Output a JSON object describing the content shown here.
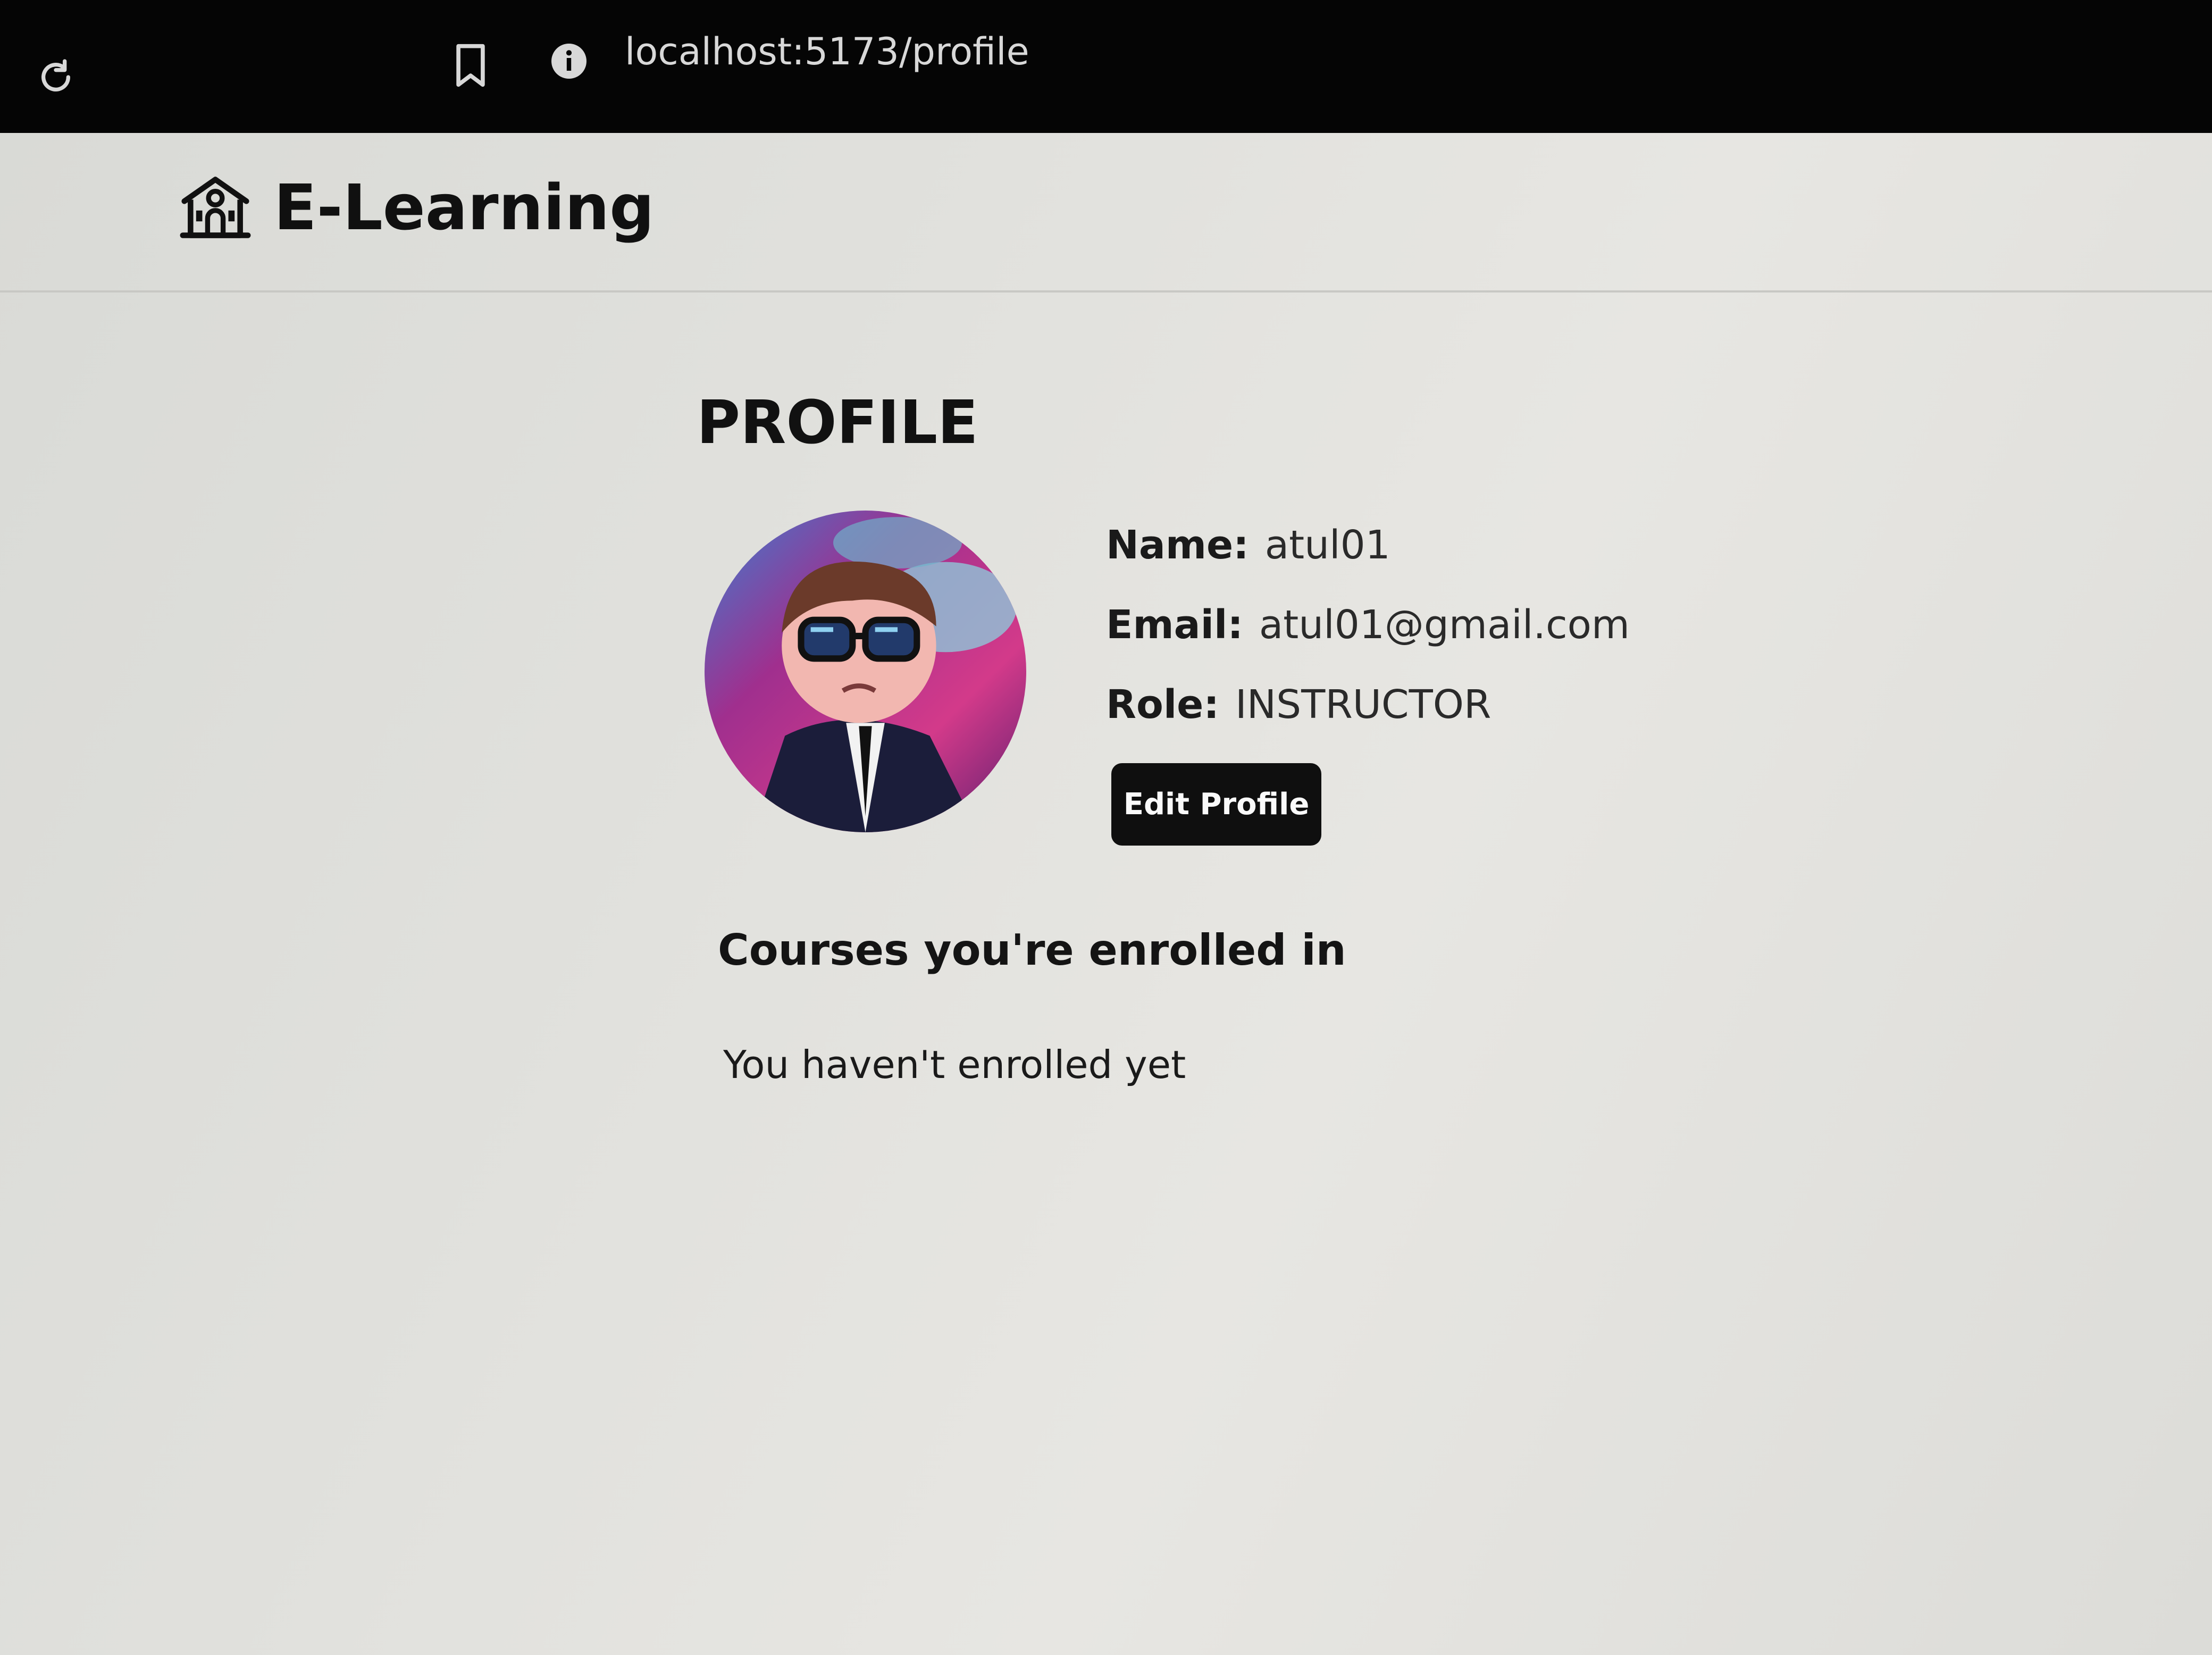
{
  "browser": {
    "url": "localhost:5173/profile",
    "icons": [
      "reload-icon",
      "bookmark-icon",
      "info-icon"
    ]
  },
  "navbar": {
    "brand": "E-Learning",
    "brand_icon": "school-building-icon"
  },
  "profile": {
    "heading": "PROFILE",
    "avatar": "cartoon-character-avatar",
    "fields": [
      {
        "label": "Name:",
        "value": "atul01"
      },
      {
        "label": "Email:",
        "value": "atul01@gmail.com"
      },
      {
        "label": "Role:",
        "value": "INSTRUCTOR"
      }
    ],
    "edit_button": "Edit Profile"
  },
  "courses": {
    "title": "Courses you're enrolled in",
    "empty_message": "You haven't enrolled yet"
  },
  "colors": {
    "browser_bar": "#050505",
    "page_background": "#e1e1dd",
    "button_bg": "#0f0f0f",
    "button_text": "#fafafa"
  }
}
